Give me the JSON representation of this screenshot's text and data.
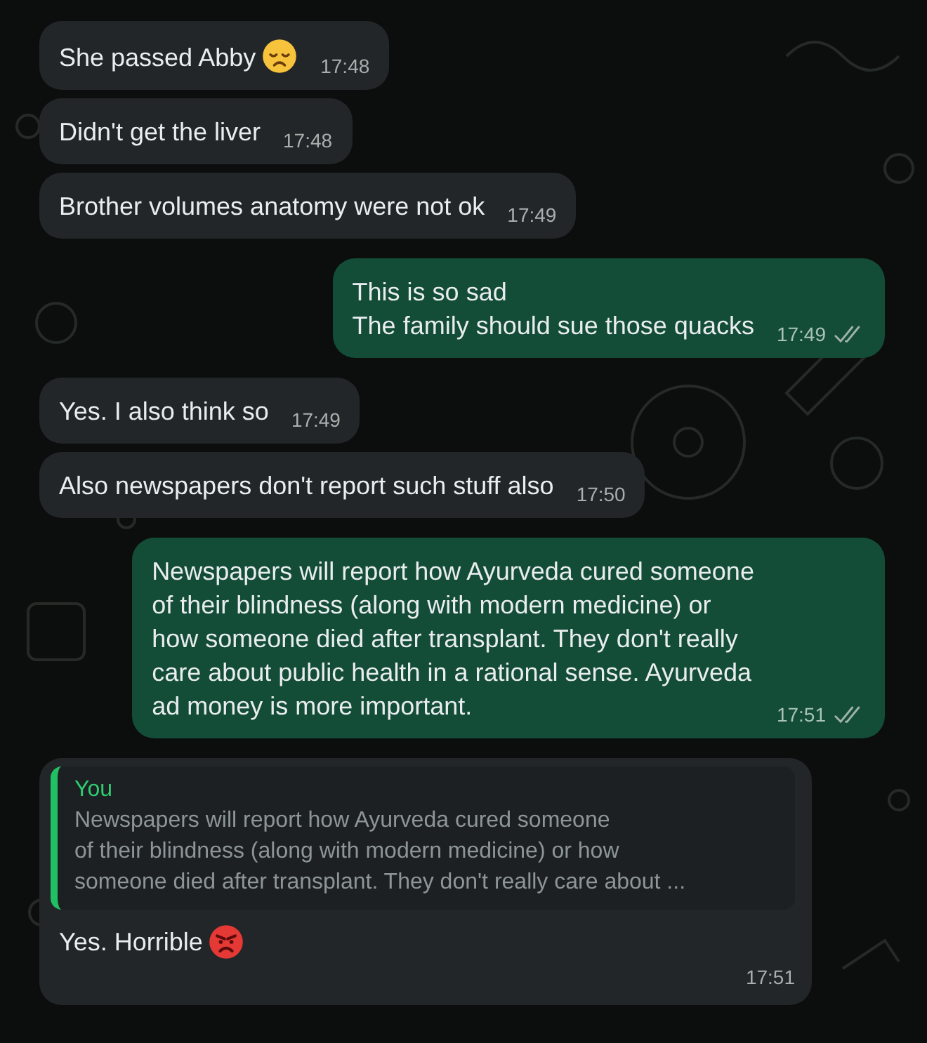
{
  "messages": [
    {
      "kind": "incoming",
      "text": "She passed Abby",
      "emoji": {
        "kind": "sad"
      },
      "time": "17:48"
    },
    {
      "kind": "incoming",
      "text": "Didn't get the liver",
      "time": "17:48"
    },
    {
      "kind": "incoming",
      "text": "Brother volumes anatomy were not ok",
      "time": "17:49"
    },
    {
      "kind": "outgoing",
      "text": "This is so sad\nThe family should sue those quacks",
      "time": "17:49",
      "read": false
    },
    {
      "kind": "incoming",
      "text": "Yes. I also think so",
      "time": "17:49"
    },
    {
      "kind": "incoming",
      "text": "Also newspapers don't report such stuff also",
      "time": "17:50"
    },
    {
      "kind": "outgoing",
      "text": "Newspapers will report how Ayurveda cured someone\nof their blindness (along with modern medicine) or\nhow someone died after transplant. They don't really\ncare about public health in a rational sense. Ayurveda\nad money is more important.",
      "time": "17:51",
      "read": false
    },
    {
      "kind": "incoming",
      "quote": {
        "author": "You",
        "text": "Newspapers will report how Ayurveda cured someone\nof their blindness (along with modern medicine) or how\nsomeone died after transplant. They don't really care about ..."
      },
      "text": "Yes. Horrible",
      "emoji": {
        "kind": "angry"
      },
      "time": "17:51"
    }
  ]
}
